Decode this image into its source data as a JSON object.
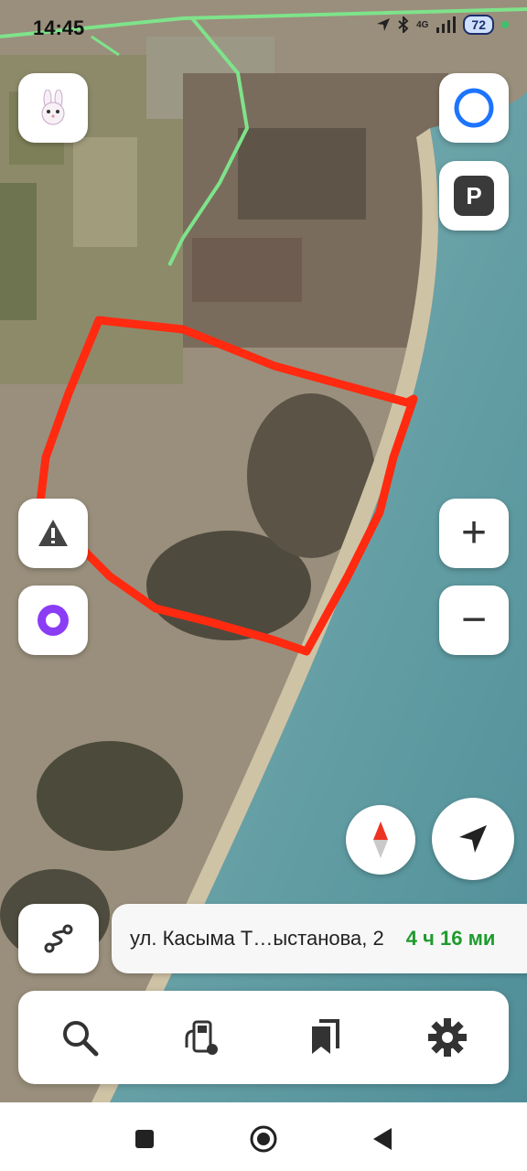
{
  "status_bar": {
    "time": "14:45",
    "network": "4G",
    "battery": "72"
  },
  "map": {
    "type": "satellite",
    "user_annotation_color": "#ff2a10"
  },
  "buttons": {
    "profile": "rabbit-icon",
    "assistant_top": "alice-circle-icon",
    "parking_label": "P",
    "warning": "warning-triangle-icon",
    "alice": "alice-ring-icon",
    "zoom_in_label": "+",
    "zoom_out_label": "−",
    "compass": "compass-icon",
    "locate": "locate-arrow-icon",
    "route": "route-icon"
  },
  "route_panel": {
    "address": "ул. Касыма Т…ыстанова, 2",
    "eta": "4 ч 16 ми"
  },
  "toolbar": {
    "items": [
      "search-icon",
      "fuel-icon",
      "bookmarks-icon",
      "settings-icon"
    ]
  },
  "colors": {
    "eta": "#1f9b2e",
    "sea": "#6aa3a8",
    "route_line": "#7ee38a"
  }
}
